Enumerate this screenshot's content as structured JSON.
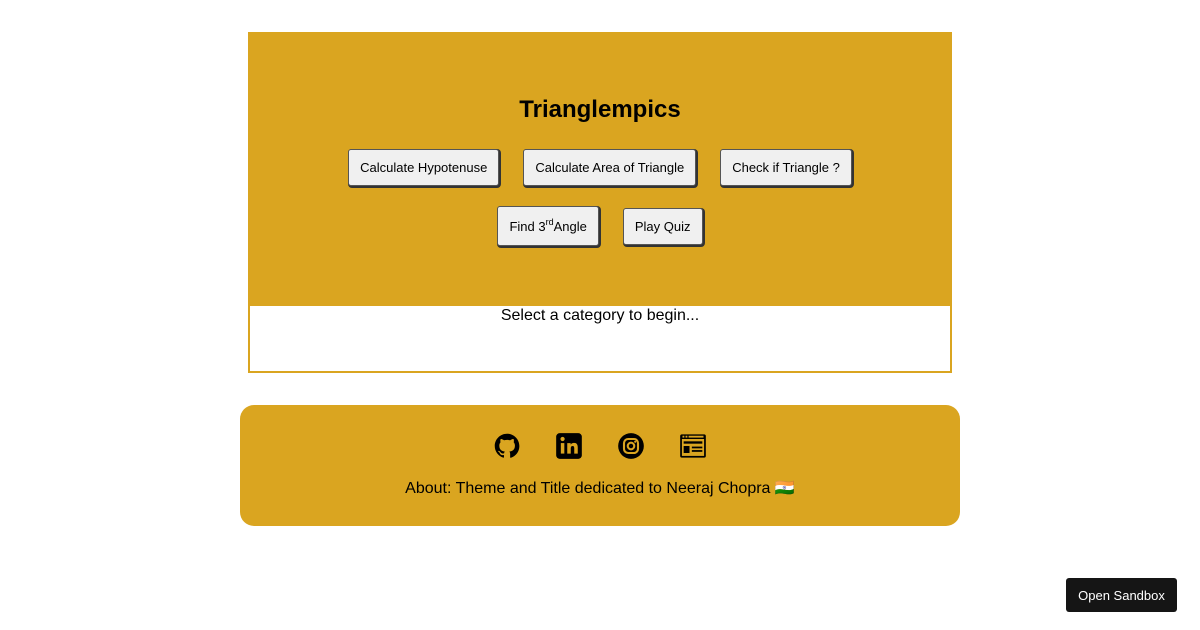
{
  "header": {
    "title": "Trianglempics"
  },
  "buttons": {
    "hypotenuse": "Calculate Hypotenuse",
    "area": "Calculate Area of Triangle",
    "check": "Check if Triangle ?",
    "angle_prefix": "Find 3",
    "angle_sup": "rd",
    "angle_suffix": "Angle",
    "quiz": "Play Quiz"
  },
  "output": {
    "message": "Select a category to begin..."
  },
  "footer": {
    "icons": [
      "github-icon",
      "linkedin-icon",
      "instagram-icon",
      "portfolio-icon"
    ],
    "about": "About: Theme and Title dedicated to Neeraj Chopra 🇮🇳"
  },
  "sandbox": {
    "label": "Open Sandbox"
  },
  "colors": {
    "accent": "#daa520",
    "button_bg": "#f0f0f0",
    "sandbox_bg": "#151515"
  }
}
